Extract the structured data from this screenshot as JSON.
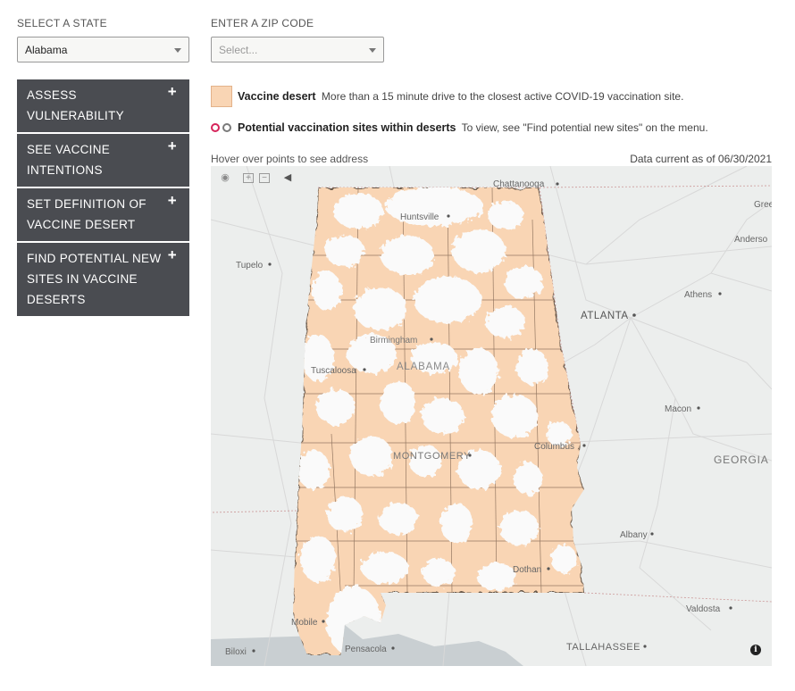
{
  "controls": {
    "state_label": "SELECT A STATE",
    "state_value": "Alabama",
    "zip_label": "ENTER A ZIP CODE",
    "zip_placeholder": "Select..."
  },
  "menu": [
    {
      "label": "ASSESS VULNERABILITY",
      "icon": "plus-icon"
    },
    {
      "label": "SEE VACCINE INTENTIONS",
      "icon": "plus-icon"
    },
    {
      "label": "SET DEFINITION OF VACCINE DESERT",
      "icon": "plus-icon"
    },
    {
      "label": "FIND POTENTIAL NEW SITES IN VACCINE DESERTS",
      "icon": "plus-icon"
    }
  ],
  "legend": {
    "desert_title": "Vaccine desert",
    "desert_desc": "More than a 15 minute drive to the closest active COVID-19 vaccination site.",
    "sites_title": "Potential vaccination sites within deserts",
    "sites_desc": "To view, see \"Find potential new sites\" on the menu.",
    "desert_color": "#f9d5b4",
    "site_colors": [
      "#d6245a",
      "#7a7a7a"
    ]
  },
  "map": {
    "hover_hint": "Hover over points to see address",
    "data_current": "Data current as of 06/30/2021",
    "toolbar": [
      "camera-icon",
      "zoom-in-icon",
      "zoom-out-icon",
      "reset-icon"
    ],
    "info_icon": "info-icon",
    "place_labels": [
      {
        "text": "Chattanooga",
        "major": false
      },
      {
        "text": "Huntsville",
        "major": false
      },
      {
        "text": "Gree",
        "major": false
      },
      {
        "text": "Anderso",
        "major": false
      },
      {
        "text": "Tupelo",
        "major": false
      },
      {
        "text": "Athens",
        "major": false
      },
      {
        "text": "ATLANTA",
        "major": true
      },
      {
        "text": "Birmingham",
        "major": false
      },
      {
        "text": "ALABAMA",
        "major": true
      },
      {
        "text": "Tuscaloosa",
        "major": false
      },
      {
        "text": "Macon",
        "major": false
      },
      {
        "text": "Columbus",
        "major": false
      },
      {
        "text": "MONTGOMERY",
        "major": true
      },
      {
        "text": "GEORGIA",
        "major": true
      },
      {
        "text": "Albany",
        "major": false
      },
      {
        "text": "Dothan",
        "major": false
      },
      {
        "text": "Valdosta",
        "major": false
      },
      {
        "text": "Mobile",
        "major": false
      },
      {
        "text": "Biloxi",
        "major": false
      },
      {
        "text": "Pensacola",
        "major": false
      },
      {
        "text": "TALLAHASSEE",
        "major": true
      }
    ]
  }
}
